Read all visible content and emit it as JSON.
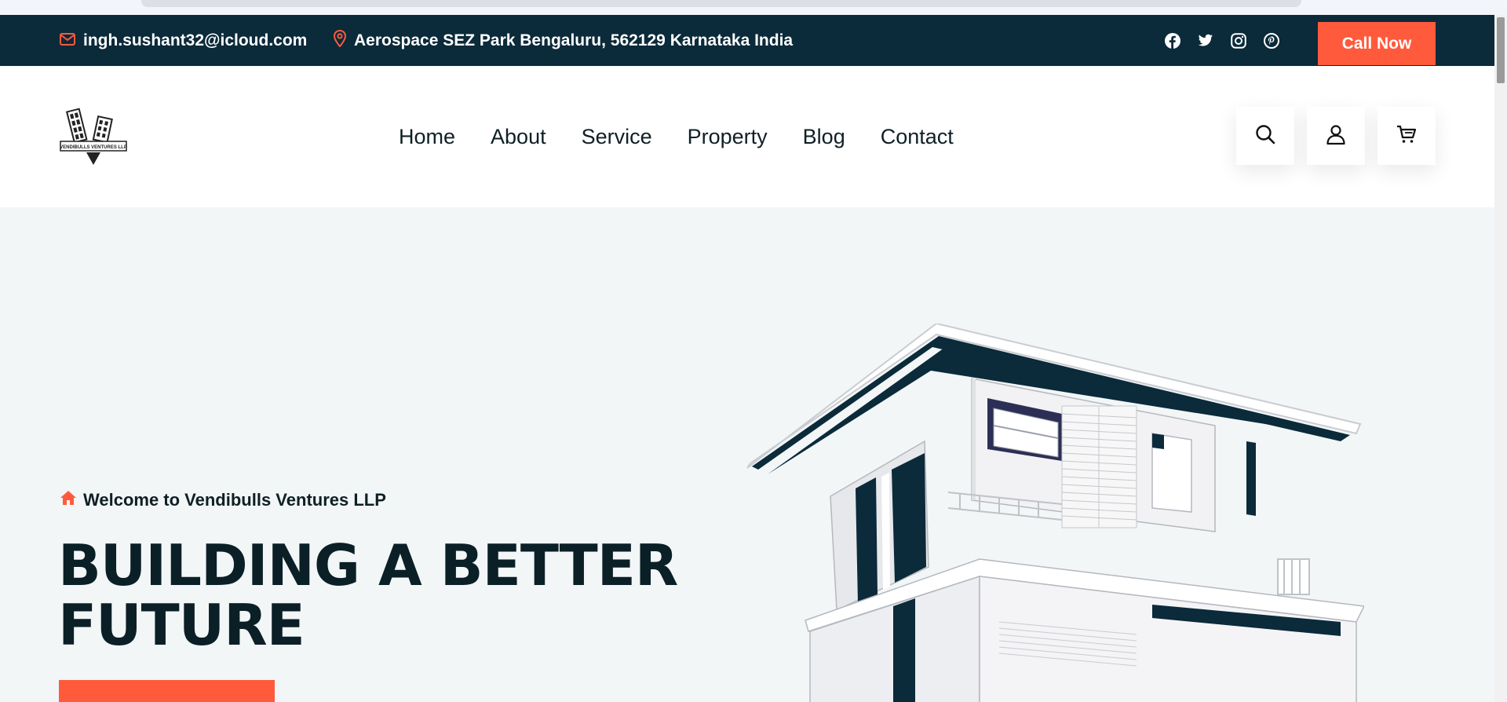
{
  "topbar": {
    "email": "ingh.sushant32@icloud.com",
    "address": "Aerospace SEZ Park Bengaluru, 562129 Karnataka India",
    "socials": [
      "facebook-icon",
      "twitter-icon",
      "instagram-icon",
      "pinterest-icon"
    ],
    "call_label": "Call Now"
  },
  "logo": {
    "text": "VENDIBULLS VENTURES LLP"
  },
  "nav": {
    "items": [
      {
        "label": "Home"
      },
      {
        "label": "About"
      },
      {
        "label": "Service"
      },
      {
        "label": "Property"
      },
      {
        "label": "Blog"
      },
      {
        "label": "Contact"
      }
    ]
  },
  "header_icons": [
    "search-icon",
    "user-icon",
    "cart-icon"
  ],
  "hero": {
    "welcome": "Welcome to Vendibulls Ventures LLP",
    "headline_line1": "BUILDING A BETTER",
    "headline_line2": "FUTURE"
  },
  "colors": {
    "accent": "#ff5a3c",
    "dark": "#0b2a3a",
    "hero_bg": "#f2f6f7"
  }
}
